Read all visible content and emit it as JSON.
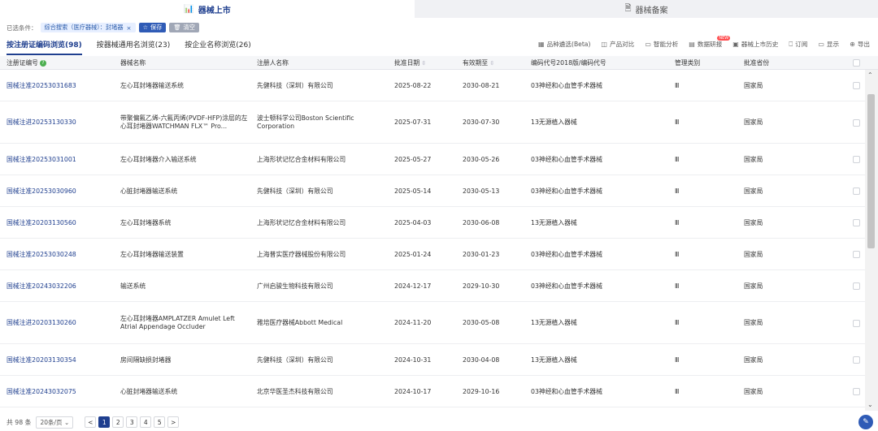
{
  "top_tabs": [
    {
      "label": "器械上市",
      "icon": "bar-chart-icon",
      "active": true
    },
    {
      "label": "器械备案",
      "icon": "record-icon",
      "active": false
    }
  ],
  "filter": {
    "label": "已选条件：",
    "chip": "综合搜索（医疗器械）：封堵器",
    "chip_close": "×",
    "save_label": "保存",
    "clear_label": "清空"
  },
  "subtabs": [
    {
      "label": "按注册证编码浏览(98)",
      "active": true
    },
    {
      "label": "按器械通用名浏览(23)",
      "active": false
    },
    {
      "label": "按企业名称浏览(26)",
      "active": false
    }
  ],
  "toolbar": [
    {
      "label": "品种遴选(Beta)",
      "icon": "grid-icon"
    },
    {
      "label": "产品对比",
      "icon": "compare-icon"
    },
    {
      "label": "智能分析",
      "icon": "monitor-icon"
    },
    {
      "label": "数据研报",
      "icon": "report-icon",
      "badge": "NEW"
    },
    {
      "label": "器械上市历史",
      "icon": "history-icon"
    },
    {
      "label": "订阅",
      "icon": "bookmark-icon"
    },
    {
      "label": "显示",
      "icon": "display-icon"
    },
    {
      "label": "导出",
      "icon": "export-icon"
    }
  ],
  "columns": {
    "reg_no": "注册证编号",
    "name": "器械名称",
    "registrant": "注册人名称",
    "approval_date": "批准日期",
    "valid_until": "有效期至",
    "code": "编码代号2018版/编码代号",
    "mgmt_class": "管理类别",
    "province": "批准省份"
  },
  "rows": [
    {
      "reg_no": "国械注准20253031683",
      "name": "左心耳封堵器输送系统",
      "registrant": "先健科技（深圳）有限公司",
      "approval_date": "2025-08-22",
      "valid_until": "2030-08-21",
      "code": "03神经和心血管手术器械",
      "mgmt_class": "Ⅲ",
      "province": "国家局"
    },
    {
      "reg_no": "国械注进20253130330",
      "name": "带聚偏氟乙烯-六氟丙烯(PVDF-HFP)涂层的左心耳封堵器WATCHMAN FLX™ Pro...",
      "registrant": "波士顿科学公司Boston Scientific Corporation",
      "approval_date": "2025-07-31",
      "valid_until": "2030-07-30",
      "code": "13无源植入器械",
      "mgmt_class": "Ⅲ",
      "province": "国家局"
    },
    {
      "reg_no": "国械注准20253031001",
      "name": "左心耳封堵器介入输送系统",
      "registrant": "上海形状记忆合金材料有限公司",
      "approval_date": "2025-05-27",
      "valid_until": "2030-05-26",
      "code": "03神经和心血管手术器械",
      "mgmt_class": "Ⅲ",
      "province": "国家局"
    },
    {
      "reg_no": "国械注准20253030960",
      "name": "心脏封堵器输送系统",
      "registrant": "先健科技（深圳）有限公司",
      "approval_date": "2025-05-14",
      "valid_until": "2030-05-13",
      "code": "03神经和心血管手术器械",
      "mgmt_class": "Ⅲ",
      "province": "国家局"
    },
    {
      "reg_no": "国械注准20203130560",
      "name": "左心耳封堵器系统",
      "registrant": "上海形状记忆合金材料有限公司",
      "approval_date": "2025-04-03",
      "valid_until": "2030-06-08",
      "code": "13无源植入器械",
      "mgmt_class": "Ⅲ",
      "province": "国家局"
    },
    {
      "reg_no": "国械注准20253030248",
      "name": "左心耳封堵器输送装置",
      "registrant": "上海普实医疗器械股份有限公司",
      "approval_date": "2025-01-24",
      "valid_until": "2030-01-23",
      "code": "03神经和心血管手术器械",
      "mgmt_class": "Ⅲ",
      "province": "国家局"
    },
    {
      "reg_no": "国械注准20243032206",
      "name": "输送系统",
      "registrant": "广州启骏生物科技有限公司",
      "approval_date": "2024-12-17",
      "valid_until": "2029-10-30",
      "code": "03神经和心血管手术器械",
      "mgmt_class": "Ⅲ",
      "province": "国家局"
    },
    {
      "reg_no": "国械注进20203130260",
      "name": "左心耳封堵器AMPLATZER Amulet Left Atrial Appendage Occluder",
      "registrant": "雅培医疗器械Abbott Medical",
      "approval_date": "2024-11-20",
      "valid_until": "2030-05-08",
      "code": "13无源植入器械",
      "mgmt_class": "Ⅲ",
      "province": "国家局"
    },
    {
      "reg_no": "国械注准20203130354",
      "name": "房间隔缺损封堵器",
      "registrant": "先健科技（深圳）有限公司",
      "approval_date": "2024-10-31",
      "valid_until": "2030-04-08",
      "code": "13无源植入器械",
      "mgmt_class": "Ⅲ",
      "province": "国家局"
    },
    {
      "reg_no": "国械注准20243032075",
      "name": "心脏封堵器输送系统",
      "registrant": "北京华医圣杰科技有限公司",
      "approval_date": "2024-10-17",
      "valid_until": "2029-10-16",
      "code": "03神经和心血管手术器械",
      "mgmt_class": "Ⅲ",
      "province": "国家局"
    }
  ],
  "footer": {
    "total": "共 98 条",
    "page_size": "20条/页",
    "pages": [
      "1",
      "2",
      "3",
      "4",
      "5"
    ],
    "current_page": "1",
    "prev": "<",
    "next": ">"
  },
  "colors": {
    "primary": "#1f3f8f",
    "accent": "#2f5bb6",
    "header_bg": "#f5f6f8"
  }
}
